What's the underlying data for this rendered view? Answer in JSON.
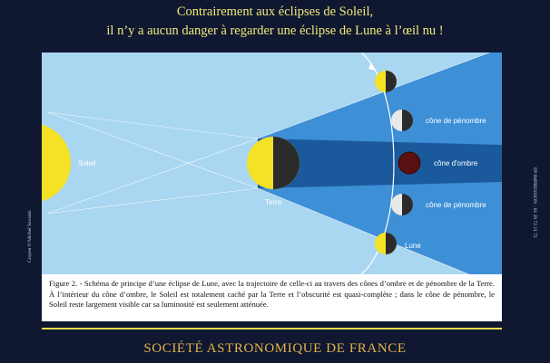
{
  "headline": {
    "line1": "Contrairement aux éclipses de Soleil,",
    "line2": "il n’y a aucun danger à regarder une éclipse de Lune à l’œil nu !"
  },
  "diagram": {
    "labels": {
      "sun": "Soleil",
      "earth": "Terre",
      "penumbra_top": "cône de pénombre",
      "umbra": "cône d'ombre",
      "penumbra_bottom": "cône de pénombre",
      "moon": "Lune"
    },
    "colors": {
      "background": "#a9d6f1",
      "sun": "#f5e226",
      "penumbra": "#3d8fd6",
      "umbra": "#1a5a9c",
      "moon_dark": "#2b2b2b",
      "eclipsed_moon": "#5a1010"
    }
  },
  "caption": "Figure 2. - Schéma de principe d’une éclipse de Lune, avec la trajectoire de celle-ci au travers des cônes d’ombre et de pénombre de la Terre. À l’intérieur du cône d’ombre, le Soleil est totalement caché par la Terre et l’obscurité est quasi-complète ; dans le cône de pénombre, le Soleil reste largement visible car sa luminosité est seulement atténuée.",
  "society": "SOCIÉTÉ ASTRONOMIQUE DE FRANCE",
  "credit_left": "Crayon © Michel Saviatis",
  "credit_right": "FP IMPRESSION · 01 39 72 21 72"
}
